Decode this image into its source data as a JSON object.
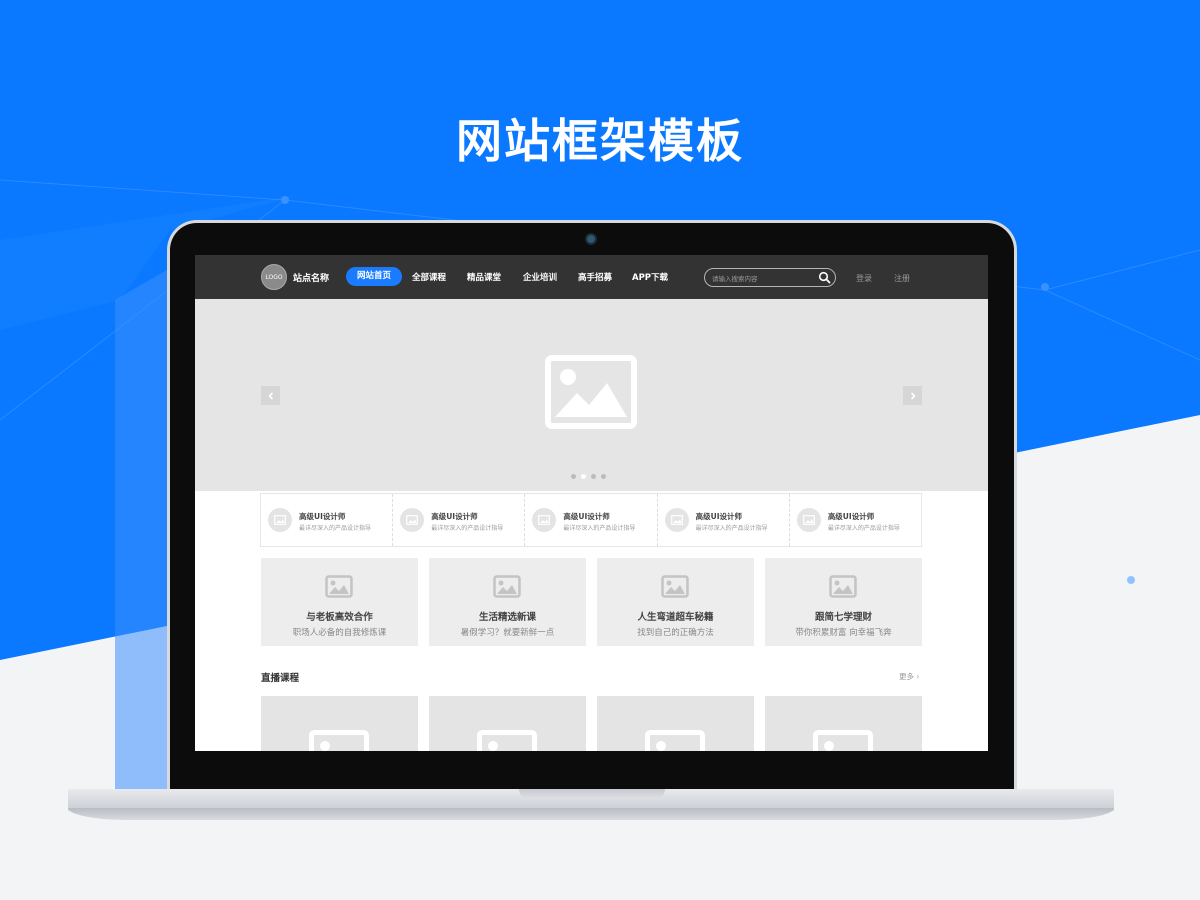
{
  "headline": "网站框架模板",
  "colors": {
    "brand_blue": "#0a78ff",
    "nav_bg": "#333333",
    "accent": "#1a7bff"
  },
  "nav": {
    "logo_text": "LOGO",
    "site_name": "站点名称",
    "items": [
      {
        "label": "网站首页",
        "active": true
      },
      {
        "label": "全部课程",
        "active": false
      },
      {
        "label": "精品课堂",
        "active": false
      },
      {
        "label": "企业培训",
        "active": false
      },
      {
        "label": "高手招募",
        "active": false
      },
      {
        "label": "APP下载",
        "active": false
      }
    ],
    "search_placeholder": "请输入搜索内容",
    "search_icon": "search-icon",
    "login": "登录",
    "register": "注册"
  },
  "banner": {
    "image_icon": "image-placeholder-icon",
    "prev_icon": "chevron-left-icon",
    "next_icon": "chevron-right-icon",
    "slide_count": 4,
    "active_slide": 2
  },
  "features": [
    {
      "title": "高级UI设计师",
      "subtitle": "最详尽深入的产品设计指导"
    },
    {
      "title": "高级UI设计师",
      "subtitle": "最详尽深入的产品设计指导"
    },
    {
      "title": "高级UI设计师",
      "subtitle": "最详尽深入的产品设计指导"
    },
    {
      "title": "高级UI设计师",
      "subtitle": "最详尽深入的产品设计指导"
    },
    {
      "title": "高级UI设计师",
      "subtitle": "最详尽深入的产品设计指导"
    }
  ],
  "cards": [
    {
      "title": "与老板高效合作",
      "subtitle": "职场人必备的自我修炼课"
    },
    {
      "title": "生活精选新课",
      "subtitle": "暑假学习？就要新鲜一点"
    },
    {
      "title": "人生弯道超车秘籍",
      "subtitle": "找到自己的正确方法"
    },
    {
      "title": "跟简七学理财",
      "subtitle": "带你积累财富 向幸福飞奔"
    }
  ],
  "live_section": {
    "title": "直播课程",
    "more": "更多 ›"
  }
}
